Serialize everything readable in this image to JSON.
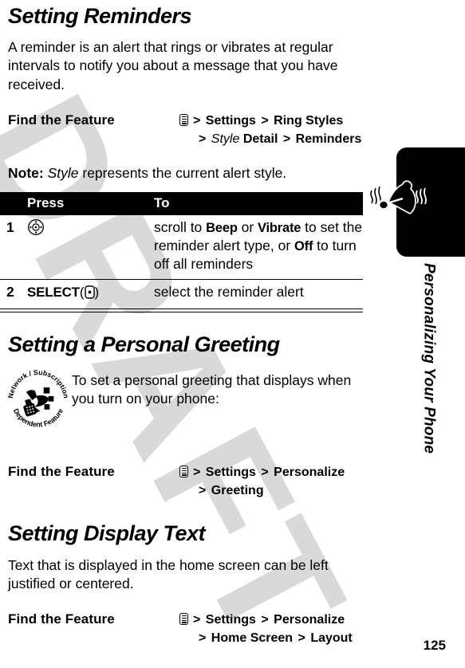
{
  "page": {
    "number": "125",
    "watermark": "DRAFT",
    "rail_title": "Personalizing Your Phone"
  },
  "sections": [
    {
      "title": "Setting Reminders",
      "body": "A reminder is an alert that rings or vibrates at regular intervals to notify you about a message that you have received."
    },
    {
      "title": "Setting a Personal Greeting",
      "body": "To set a personal greeting that displays when you turn on your phone:"
    },
    {
      "title": "Setting Display Text",
      "body": "Text that is displayed in the home screen can be left justified or centered."
    }
  ],
  "find_the_feature": {
    "label": "Find the Feature",
    "reminders": {
      "line1": {
        "gt1": ">",
        "item1": "Settings",
        "gt2": ">",
        "item2": "Ring Styles"
      },
      "line2": {
        "gt": ">",
        "italic": "Style",
        "item1": "Detail",
        "gt2": ">",
        "item2": "Reminders"
      }
    },
    "greeting": {
      "line1": {
        "gt1": ">",
        "item1": "Settings",
        "gt2": ">",
        "item2": "Personalize"
      },
      "line2": {
        "gt": ">",
        "item1": "Greeting"
      }
    },
    "display_text": {
      "line1": {
        "gt1": ">",
        "item1": "Settings",
        "gt2": ">",
        "item2": "Personalize"
      },
      "line2": {
        "gt": ">",
        "item1": "Home Screen",
        "gt2": ">",
        "item2": "Layout"
      }
    }
  },
  "note": {
    "label": "Note:",
    "italic_word": "Style",
    "rest": " represents the current alert style."
  },
  "steps_table": {
    "headers": {
      "num": "",
      "press": "Press",
      "to": "To"
    },
    "rows": [
      {
        "num": "1",
        "press_icon": "navigation-key-icon",
        "press_label": "",
        "to_parts": [
          {
            "t": "scroll to ",
            "b": false
          },
          {
            "t": "Beep",
            "b": true
          },
          {
            "t": " or ",
            "b": false
          },
          {
            "t": "Vibrate",
            "b": true
          },
          {
            "t": " to set the reminder alert type, or ",
            "b": false
          },
          {
            "t": "Off",
            "b": true
          },
          {
            "t": " to turn off all reminders",
            "b": false
          }
        ]
      },
      {
        "num": "2",
        "press_icon": "select-key-icon",
        "press_label": "SELECT",
        "press_paren_open": "(",
        "press_paren_close": ")",
        "to_plain": "select the reminder alert"
      }
    ]
  },
  "badge": {
    "top_text": "Network / Subscription",
    "bottom_text": "Dependent Feature"
  }
}
